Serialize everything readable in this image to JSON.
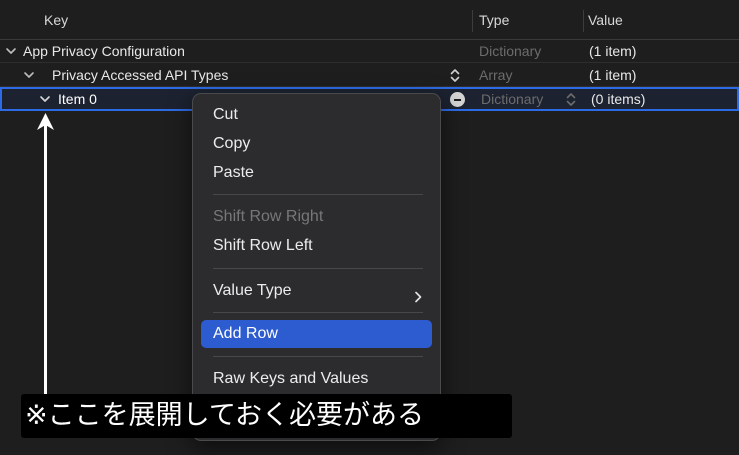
{
  "table": {
    "headers": {
      "key": "Key",
      "type": "Type",
      "value": "Value"
    },
    "rows": [
      {
        "key": "App Privacy Configuration",
        "type": "Dictionary",
        "value": "(1 item)",
        "expanded": true
      },
      {
        "key": "Privacy Accessed API Types",
        "type": "Array",
        "value": "(1 item)",
        "expanded": true
      },
      {
        "key": "Item 0",
        "type": "Dictionary",
        "value": "(0 items)",
        "expanded": true,
        "selected": true
      }
    ]
  },
  "context_menu": {
    "items": [
      {
        "label": "Cut",
        "enabled": true
      },
      {
        "label": "Copy",
        "enabled": true
      },
      {
        "label": "Paste",
        "enabled": true
      },
      {
        "label": "Shift Row Right",
        "enabled": false
      },
      {
        "label": "Shift Row Left",
        "enabled": true
      },
      {
        "label": "Value Type",
        "enabled": true,
        "submenu": true
      },
      {
        "label": "Add Row",
        "enabled": true,
        "highlighted": true
      },
      {
        "label": "Raw Keys and Values",
        "enabled": true
      }
    ]
  },
  "annotation": {
    "caption": "※ここを展開しておく必要がある"
  },
  "colors": {
    "background": "#1e1e1e",
    "selection_border": "#2d6be6",
    "menu_highlight": "#2d5bd0"
  }
}
